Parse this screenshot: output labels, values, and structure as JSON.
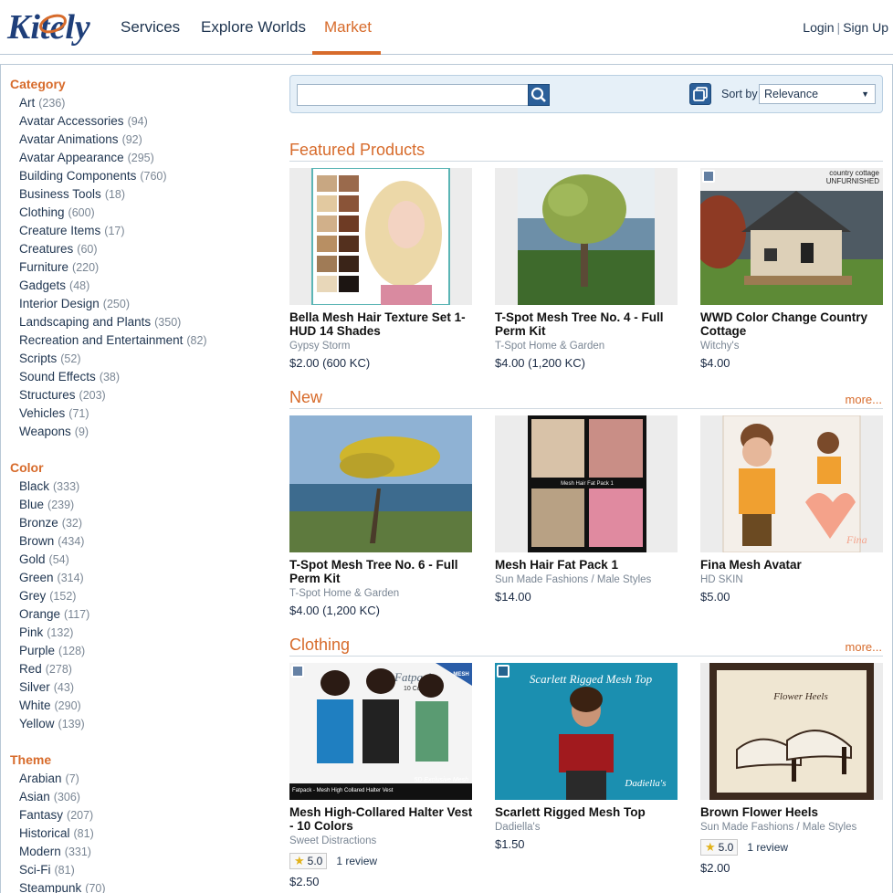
{
  "header": {
    "logo_text": "Kitely",
    "nav": [
      "Services",
      "Explore Worlds",
      "Market"
    ],
    "login": "Login",
    "separator": "|",
    "signup": "Sign Up"
  },
  "sidebar": {
    "facets": [
      {
        "title": "Category",
        "items": [
          {
            "label": "Art",
            "count": "(236)"
          },
          {
            "label": "Avatar Accessories",
            "count": "(94)"
          },
          {
            "label": "Avatar Animations",
            "count": "(92)"
          },
          {
            "label": "Avatar Appearance",
            "count": "(295)"
          },
          {
            "label": "Building Components",
            "count": "(760)"
          },
          {
            "label": "Business Tools",
            "count": "(18)"
          },
          {
            "label": "Clothing",
            "count": "(600)"
          },
          {
            "label": "Creature Items",
            "count": "(17)"
          },
          {
            "label": "Creatures",
            "count": "(60)"
          },
          {
            "label": "Furniture",
            "count": "(220)"
          },
          {
            "label": "Gadgets",
            "count": "(48)"
          },
          {
            "label": "Interior Design",
            "count": "(250)"
          },
          {
            "label": "Landscaping and Plants",
            "count": "(350)"
          },
          {
            "label": "Recreation and Entertainment",
            "count": "(82)"
          },
          {
            "label": "Scripts",
            "count": "(52)"
          },
          {
            "label": "Sound Effects",
            "count": "(38)"
          },
          {
            "label": "Structures",
            "count": "(203)"
          },
          {
            "label": "Vehicles",
            "count": "(71)"
          },
          {
            "label": "Weapons",
            "count": "(9)"
          }
        ]
      },
      {
        "title": "Color",
        "items": [
          {
            "label": "Black",
            "count": "(333)"
          },
          {
            "label": "Blue",
            "count": "(239)"
          },
          {
            "label": "Bronze",
            "count": "(32)"
          },
          {
            "label": "Brown",
            "count": "(434)"
          },
          {
            "label": "Gold",
            "count": "(54)"
          },
          {
            "label": "Green",
            "count": "(314)"
          },
          {
            "label": "Grey",
            "count": "(152)"
          },
          {
            "label": "Orange",
            "count": "(117)"
          },
          {
            "label": "Pink",
            "count": "(132)"
          },
          {
            "label": "Purple",
            "count": "(128)"
          },
          {
            "label": "Red",
            "count": "(278)"
          },
          {
            "label": "Silver",
            "count": "(43)"
          },
          {
            "label": "White",
            "count": "(290)"
          },
          {
            "label": "Yellow",
            "count": "(139)"
          }
        ]
      },
      {
        "title": "Theme",
        "items": [
          {
            "label": "Arabian",
            "count": "(7)"
          },
          {
            "label": "Asian",
            "count": "(306)"
          },
          {
            "label": "Fantasy",
            "count": "(207)"
          },
          {
            "label": "Historical",
            "count": "(81)"
          },
          {
            "label": "Modern",
            "count": "(331)"
          },
          {
            "label": "Sci-Fi",
            "count": "(81)"
          },
          {
            "label": "Steampunk",
            "count": "(70)"
          }
        ]
      }
    ]
  },
  "search": {
    "placeholder": "",
    "sort_label": "Sort by",
    "sort_value": "Relevance"
  },
  "sections": {
    "featured": {
      "title": "Featured Products",
      "products": [
        {
          "title": "Bella Mesh Hair Texture Set 1- HUD 14 Shades",
          "seller": "Gypsy Storm",
          "price": "$2.00 (600 KC)"
        },
        {
          "title": "T-Spot Mesh Tree No. 4 - Full Perm Kit",
          "seller": "T-Spot Home & Garden",
          "price": "$4.00 (1,200 KC)"
        },
        {
          "title": "WWD Color Change Country Cottage",
          "seller": "Witchy's",
          "price": "$4.00"
        }
      ]
    },
    "new": {
      "title": "New",
      "more": "more...",
      "products": [
        {
          "title": "T-Spot Mesh Tree No. 6 - Full Perm Kit",
          "seller": "T-Spot Home & Garden",
          "price": "$4.00 (1,200 KC)"
        },
        {
          "title": "Mesh Hair Fat Pack 1",
          "seller": "Sun Made Fashions / Male Styles",
          "price": "$14.00"
        },
        {
          "title": "Fina Mesh Avatar",
          "seller": "HD SKIN",
          "price": "$5.00"
        }
      ]
    },
    "clothing": {
      "title": "Clothing",
      "more": "more...",
      "products": [
        {
          "title": "Mesh High-Collared Halter Vest - 10 Colors",
          "seller": "Sweet Distractions",
          "rating": "5.0",
          "reviews": "1 review",
          "price": "$2.50"
        },
        {
          "title": "Scarlett Rigged Mesh Top",
          "seller": "Dadiella's",
          "price": "$1.50"
        },
        {
          "title": "Brown Flower Heels",
          "seller": "Sun Made Fashions / Male Styles",
          "rating": "5.0",
          "reviews": "1 review",
          "price": "$2.00"
        }
      ]
    }
  },
  "thumb_text": {
    "cottage_line1": "country cottage",
    "cottage_line2": "UNFURNISHED",
    "fatpack_label": "Mesh Hair Fat Pack 1",
    "vest_brand": "Fatpack",
    "vest_colors": "10 Colors",
    "vest_badge": "MESH",
    "vest_exclusive": "5D Exclusive Mesh",
    "vest_caption": "Fatpack - Mesh High Collared Halter Vest",
    "scarlett_title": "Scarlett Rigged Mesh Top",
    "scarlett_brand": "Dadiella's",
    "heels_title": "Flower Heels",
    "avatar_caption": "Fina"
  }
}
